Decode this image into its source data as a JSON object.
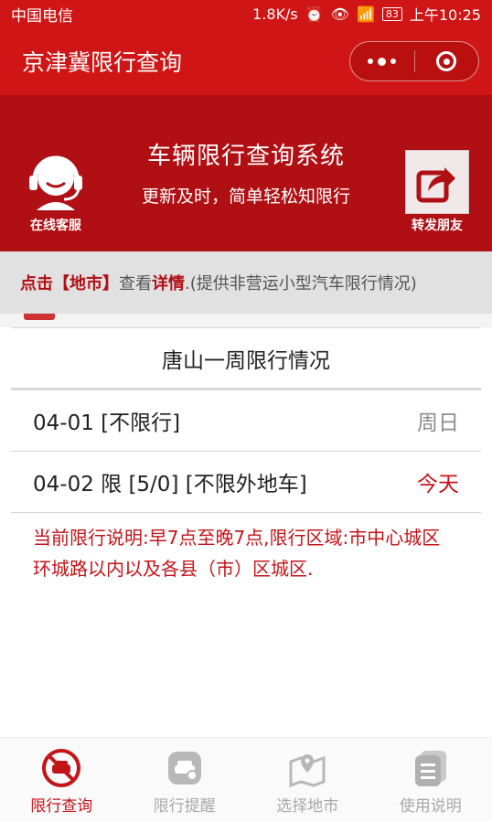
{
  "status_bar": {
    "carrier": "中国电信",
    "speed": "1.8K/s",
    "battery": "83",
    "time": "上午10:25"
  },
  "nav": {
    "title": "京津冀限行查询"
  },
  "banner": {
    "title": "车辆限行查询系统",
    "subtitle": "更新及时，简单轻松知限行",
    "service_label": "在线客服",
    "share_label": "转发朋友"
  },
  "notice": {
    "prefix": "点击【地市】",
    "mid": "查看",
    "detail": "详情",
    "suffix": ".(提供非营运小型汽车限行情况)"
  },
  "panel": {
    "title": "唐山一周限行情况",
    "rows": [
      {
        "date_rule": "04-01 [不限行]",
        "day": "周日"
      },
      {
        "date_rule": "04-02 限 [5/0] [不限外地车]",
        "day": "今天"
      }
    ],
    "explanation": "当前限行说明:早7点至晚7点,限行区域:市中心城区环城路以内以及各县（市）区城区."
  },
  "tabbar": {
    "tabs": [
      {
        "label": "限行查询",
        "icon": "no-parking-icon",
        "active": true
      },
      {
        "label": "限行提醒",
        "icon": "car-bell-icon",
        "active": false
      },
      {
        "label": "选择地市",
        "icon": "map-pin-icon",
        "active": false
      },
      {
        "label": "使用说明",
        "icon": "document-icon",
        "active": false
      }
    ]
  },
  "colors": {
    "brand_red": "#cf1515",
    "banner_red": "#b00f14",
    "accent_text": "#c3141a"
  }
}
